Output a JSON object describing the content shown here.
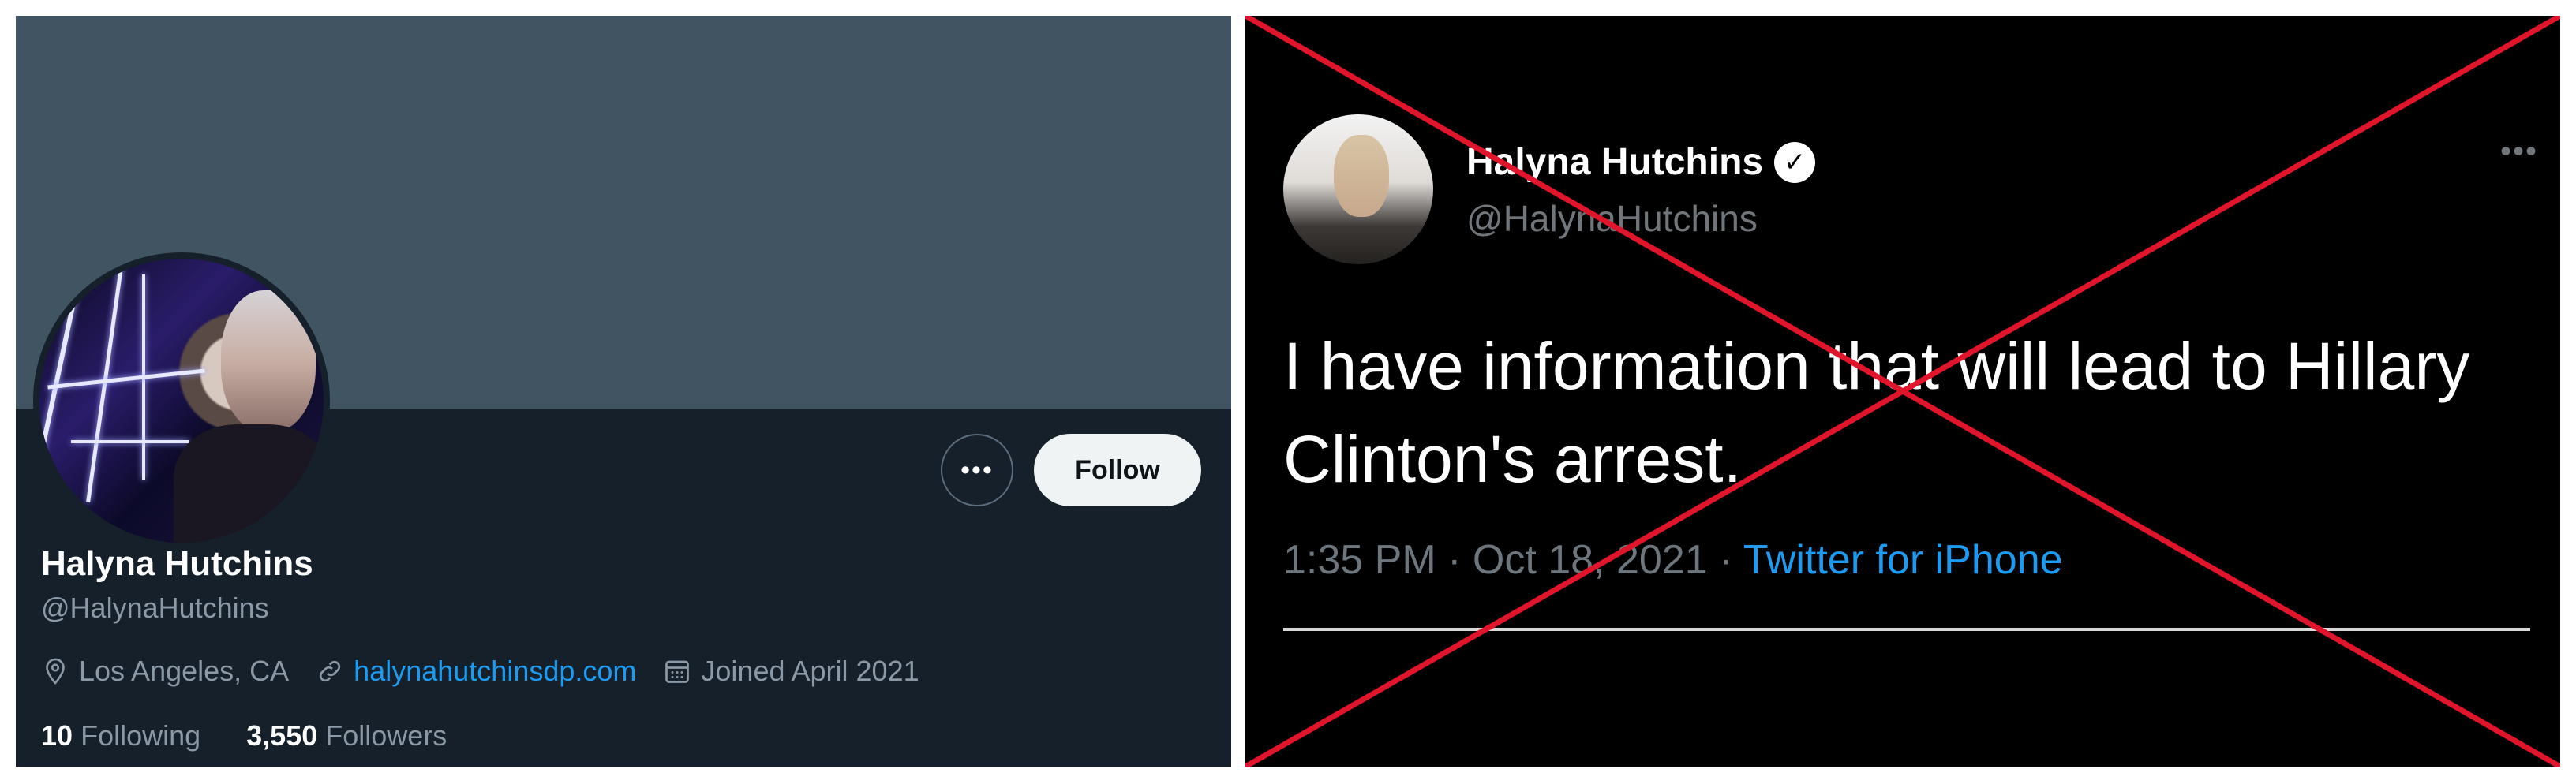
{
  "profile": {
    "name": "Halyna Hutchins",
    "handle": "@HalynaHutchins",
    "location": "Los Angeles, CA",
    "website": "halynahutchinsdp.com",
    "joined": "Joined April 2021",
    "following_count": "10",
    "following_label": "Following",
    "followers_count": "3,550",
    "followers_label": "Followers",
    "follow_label": "Follow",
    "more_label": "•••",
    "icons": [
      "location-pin-icon",
      "link-icon",
      "calendar-icon",
      "more-dots-icon"
    ]
  },
  "tweet": {
    "name": "Halyna Hutchins",
    "handle": "@HalynaHutchins",
    "text": "I have information that will lead to Hillary Clinton's arrest.",
    "time": "1:35 PM · Oct 18, 2021 · ",
    "source": "Twitter for iPhone",
    "verified_glyph": "✓",
    "more_label": "•••",
    "overlay": "red-x-cross"
  },
  "colors": {
    "profile_bg": "#15202b",
    "banner": "#415462",
    "link": "#1d9bf0",
    "tweet_bg": "#000000",
    "cross": "#e0142a"
  }
}
